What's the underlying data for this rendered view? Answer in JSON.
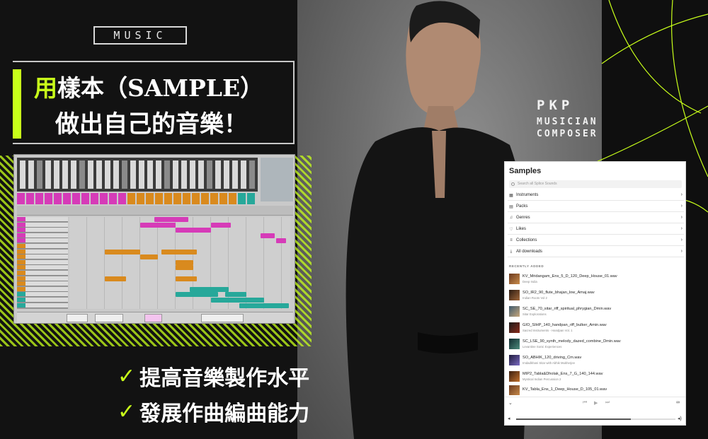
{
  "badge": {
    "label": "MUSIC"
  },
  "headline": {
    "line1_accent": "用",
    "line1_rest": "樣本（SAMPLE）",
    "line2": "做出自己的音樂！"
  },
  "brand": {
    "name": "PKP",
    "role1": "MUSICIAN",
    "role2": "COMPOSER"
  },
  "checks": [
    {
      "icon": "check-icon",
      "text": "提高音樂製作水平"
    },
    {
      "icon": "check-icon",
      "text": "發展作曲編曲能力"
    }
  ],
  "colors": {
    "accent": "#c8ff1a",
    "magenta": "#d63bb8",
    "orange": "#d98a1e",
    "teal": "#27a89a"
  },
  "samples": {
    "title": "Samples",
    "search_placeholder": "Search all Splice Sounds",
    "nav": [
      {
        "label": "Instruments",
        "icon": "instruments-icon"
      },
      {
        "label": "Packs",
        "icon": "packs-icon"
      },
      {
        "label": "Genres",
        "icon": "genres-icon"
      },
      {
        "label": "Likes",
        "icon": "heart-icon"
      },
      {
        "label": "Collections",
        "icon": "collections-icon"
      },
      {
        "label": "All downloads",
        "icon": "downloads-icon"
      }
    ],
    "recent_label": "RECENTLY ADDED",
    "recent": [
      {
        "name": "KV_Mridangam_Ens_5_D_120_Deep_House_01.wav",
        "pack": "Deep India"
      },
      {
        "name": "SO_IR2_90_flute_bhajan_low_Amaj.wav",
        "pack": "Indian Roots Vol 2"
      },
      {
        "name": "SC_SE_70_sitar_riff_spiritual_phrygian_Dmin.wav",
        "pack": "Sitar Explorations"
      },
      {
        "name": "GIO_SIHP_140_handpan_riff_bulker_Amin.wav",
        "pack": "Sacred Instruments - Handpan Vol. 1"
      },
      {
        "name": "SC_LSE_90_synth_melody_dazed_combine_Dmin.wav",
        "pack": "Levantine Sonic Experiences"
      },
      {
        "name": "SO_ABHIK_120_driving_Cm.wav",
        "pack": "Imdadkhani Sitar with Abhik Mukherjee"
      },
      {
        "name": "MIP2_Tabla&Dholak_Ens_7_G_140_144.wav",
        "pack": "Mystical Indian Percussion 2"
      },
      {
        "name": "KV_Tabla_Ens_1_Deep_House_D_105_01.wav",
        "pack": ""
      }
    ],
    "player": {
      "progress": 0.72
    }
  }
}
